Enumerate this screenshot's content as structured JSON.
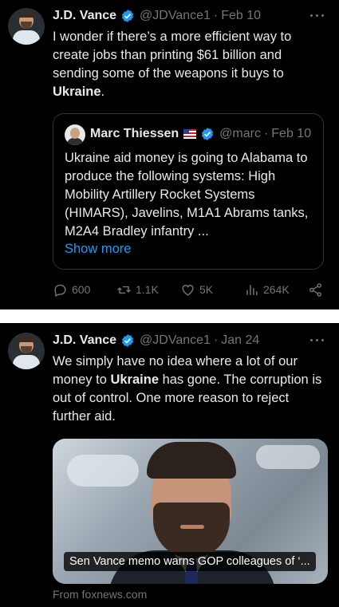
{
  "tweets": [
    {
      "author_name": "J.D. Vance",
      "handle": "@JDVance1",
      "separator": "·",
      "date": "Feb 10",
      "text_before": "I wonder if there’s a more efficient way to create jobs than printing $61 billion and sending some of the weapons it buys to ",
      "text_bold": "Ukraine",
      "text_after": ".",
      "quote": {
        "author_name": "Marc Thiessen",
        "handle": "@marc",
        "separator": "·",
        "date": "Feb 10",
        "text": "Ukraine aid money is going to Alabama to produce the following systems: High Mobility Artillery Rocket Systems (HIMARS), Javelins, M1A1 Abrams tanks, M2A4 Bradley infantry ...",
        "show_more": "Show more"
      },
      "metrics": {
        "replies": "600",
        "reposts": "1.1K",
        "likes": "5K",
        "views": "264K"
      }
    },
    {
      "author_name": "J.D. Vance",
      "handle": "@JDVance1",
      "separator": "·",
      "date": "Jan 24",
      "text_before": "We simply have no idea where a lot of our money to ",
      "text_bold": "Ukraine",
      "text_after": " has gone. The corruption is out of control. One more reason to reject further aid.",
      "link_card": {
        "caption": "Sen Vance memo warns GOP colleagues of ‘...",
        "source": "From foxnews.com"
      }
    }
  ],
  "colors": {
    "background": "#000000",
    "text": "#e7e9ea",
    "muted": "#71767b",
    "link": "#1d9bf0",
    "verified": "#1d9bf0",
    "border": "#2f3336"
  }
}
